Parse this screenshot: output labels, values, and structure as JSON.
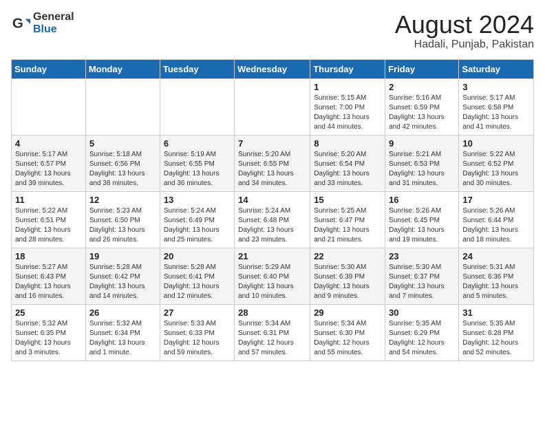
{
  "header": {
    "logo_general": "General",
    "logo_blue": "Blue",
    "title": "August 2024",
    "subtitle": "Hadali, Punjab, Pakistan"
  },
  "weekdays": [
    "Sunday",
    "Monday",
    "Tuesday",
    "Wednesday",
    "Thursday",
    "Friday",
    "Saturday"
  ],
  "weeks": [
    [
      {
        "day": "",
        "info": ""
      },
      {
        "day": "",
        "info": ""
      },
      {
        "day": "",
        "info": ""
      },
      {
        "day": "",
        "info": ""
      },
      {
        "day": "1",
        "info": "Sunrise: 5:15 AM\nSunset: 7:00 PM\nDaylight: 13 hours\nand 44 minutes."
      },
      {
        "day": "2",
        "info": "Sunrise: 5:16 AM\nSunset: 6:59 PM\nDaylight: 13 hours\nand 42 minutes."
      },
      {
        "day": "3",
        "info": "Sunrise: 5:17 AM\nSunset: 6:58 PM\nDaylight: 13 hours\nand 41 minutes."
      }
    ],
    [
      {
        "day": "4",
        "info": "Sunrise: 5:17 AM\nSunset: 6:57 PM\nDaylight: 13 hours\nand 39 minutes."
      },
      {
        "day": "5",
        "info": "Sunrise: 5:18 AM\nSunset: 6:56 PM\nDaylight: 13 hours\nand 38 minutes."
      },
      {
        "day": "6",
        "info": "Sunrise: 5:19 AM\nSunset: 6:55 PM\nDaylight: 13 hours\nand 36 minutes."
      },
      {
        "day": "7",
        "info": "Sunrise: 5:20 AM\nSunset: 6:55 PM\nDaylight: 13 hours\nand 34 minutes."
      },
      {
        "day": "8",
        "info": "Sunrise: 5:20 AM\nSunset: 6:54 PM\nDaylight: 13 hours\nand 33 minutes."
      },
      {
        "day": "9",
        "info": "Sunrise: 5:21 AM\nSunset: 6:53 PM\nDaylight: 13 hours\nand 31 minutes."
      },
      {
        "day": "10",
        "info": "Sunrise: 5:22 AM\nSunset: 6:52 PM\nDaylight: 13 hours\nand 30 minutes."
      }
    ],
    [
      {
        "day": "11",
        "info": "Sunrise: 5:22 AM\nSunset: 6:51 PM\nDaylight: 13 hours\nand 28 minutes."
      },
      {
        "day": "12",
        "info": "Sunrise: 5:23 AM\nSunset: 6:50 PM\nDaylight: 13 hours\nand 26 minutes."
      },
      {
        "day": "13",
        "info": "Sunrise: 5:24 AM\nSunset: 6:49 PM\nDaylight: 13 hours\nand 25 minutes."
      },
      {
        "day": "14",
        "info": "Sunrise: 5:24 AM\nSunset: 6:48 PM\nDaylight: 13 hours\nand 23 minutes."
      },
      {
        "day": "15",
        "info": "Sunrise: 5:25 AM\nSunset: 6:47 PM\nDaylight: 13 hours\nand 21 minutes."
      },
      {
        "day": "16",
        "info": "Sunrise: 5:26 AM\nSunset: 6:45 PM\nDaylight: 13 hours\nand 19 minutes."
      },
      {
        "day": "17",
        "info": "Sunrise: 5:26 AM\nSunset: 6:44 PM\nDaylight: 13 hours\nand 18 minutes."
      }
    ],
    [
      {
        "day": "18",
        "info": "Sunrise: 5:27 AM\nSunset: 6:43 PM\nDaylight: 13 hours\nand 16 minutes."
      },
      {
        "day": "19",
        "info": "Sunrise: 5:28 AM\nSunset: 6:42 PM\nDaylight: 13 hours\nand 14 minutes."
      },
      {
        "day": "20",
        "info": "Sunrise: 5:28 AM\nSunset: 6:41 PM\nDaylight: 13 hours\nand 12 minutes."
      },
      {
        "day": "21",
        "info": "Sunrise: 5:29 AM\nSunset: 6:40 PM\nDaylight: 13 hours\nand 10 minutes."
      },
      {
        "day": "22",
        "info": "Sunrise: 5:30 AM\nSunset: 6:39 PM\nDaylight: 13 hours\nand 9 minutes."
      },
      {
        "day": "23",
        "info": "Sunrise: 5:30 AM\nSunset: 6:37 PM\nDaylight: 13 hours\nand 7 minutes."
      },
      {
        "day": "24",
        "info": "Sunrise: 5:31 AM\nSunset: 6:36 PM\nDaylight: 13 hours\nand 5 minutes."
      }
    ],
    [
      {
        "day": "25",
        "info": "Sunrise: 5:32 AM\nSunset: 6:35 PM\nDaylight: 13 hours\nand 3 minutes."
      },
      {
        "day": "26",
        "info": "Sunrise: 5:32 AM\nSunset: 6:34 PM\nDaylight: 13 hours\nand 1 minute."
      },
      {
        "day": "27",
        "info": "Sunrise: 5:33 AM\nSunset: 6:33 PM\nDaylight: 12 hours\nand 59 minutes."
      },
      {
        "day": "28",
        "info": "Sunrise: 5:34 AM\nSunset: 6:31 PM\nDaylight: 12 hours\nand 57 minutes."
      },
      {
        "day": "29",
        "info": "Sunrise: 5:34 AM\nSunset: 6:30 PM\nDaylight: 12 hours\nand 55 minutes."
      },
      {
        "day": "30",
        "info": "Sunrise: 5:35 AM\nSunset: 6:29 PM\nDaylight: 12 hours\nand 54 minutes."
      },
      {
        "day": "31",
        "info": "Sunrise: 5:35 AM\nSunset: 6:28 PM\nDaylight: 12 hours\nand 52 minutes."
      }
    ]
  ]
}
